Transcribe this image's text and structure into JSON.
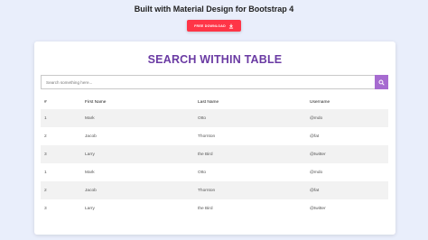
{
  "header": {
    "title": "Built with Material Design for Bootstrap 4",
    "download_label": "FREE DOWNLOAD",
    "download_icon": "download-icon",
    "download_color": "#ff3547"
  },
  "card": {
    "title": "SEARCH WITHIN TABLE",
    "title_color": "#6a3aa3"
  },
  "search": {
    "placeholder": "Search something here...",
    "value": "",
    "button_icon": "search-icon",
    "button_color": "#a66bd0"
  },
  "table": {
    "columns": [
      "#",
      "First Name",
      "Last Name",
      "Username"
    ],
    "rows": [
      [
        "1",
        "Mark",
        "Otto",
        "@mdo"
      ],
      [
        "2",
        "Jacob",
        "Thornton",
        "@fat"
      ],
      [
        "3",
        "Larry",
        "the Bird",
        "@twitter"
      ],
      [
        "1",
        "Mark",
        "Otto",
        "@mdo"
      ],
      [
        "2",
        "Jacob",
        "Thornton",
        "@fat"
      ],
      [
        "3",
        "Larry",
        "the Bird",
        "@twitter"
      ]
    ]
  }
}
